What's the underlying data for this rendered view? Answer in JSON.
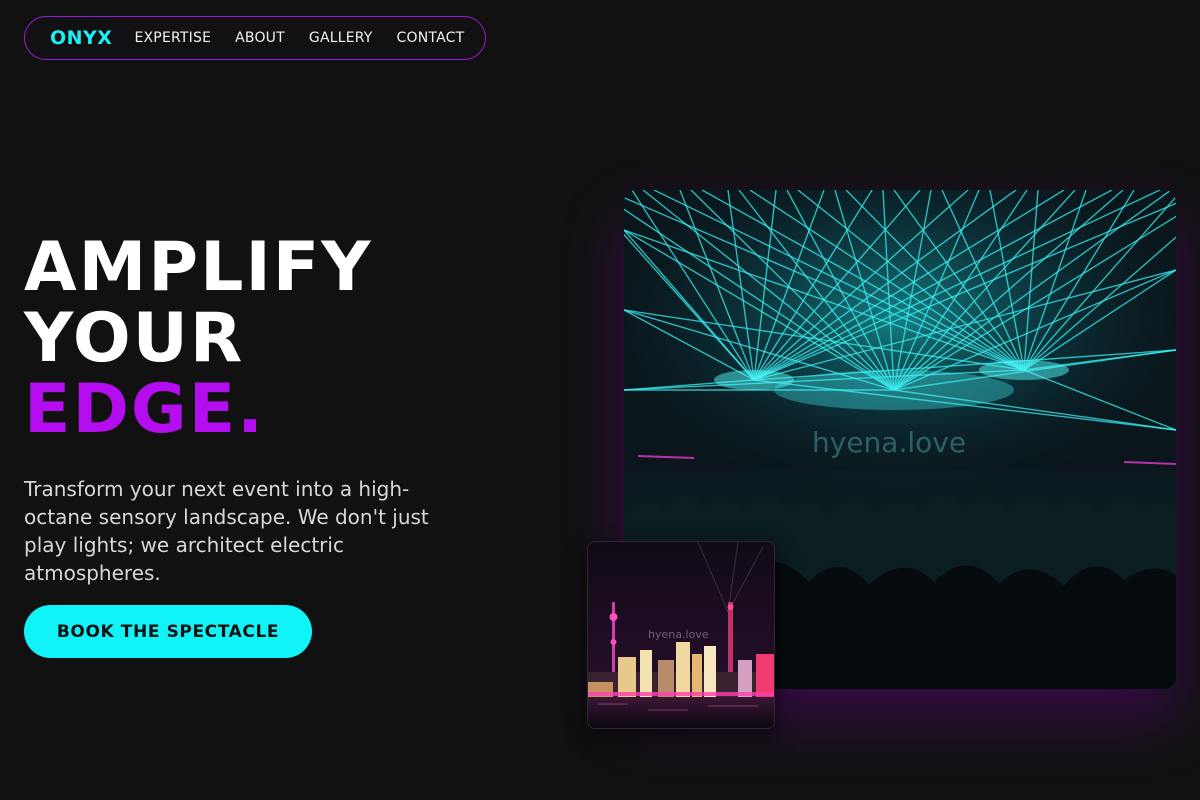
{
  "nav": {
    "logo": "ONYX",
    "links": [
      "EXPERTISE",
      "ABOUT",
      "GALLERY",
      "CONTACT"
    ]
  },
  "hero": {
    "headline_line1": "AMPLIFY",
    "headline_line2": "YOUR",
    "headline_accent": "EDGE.",
    "subcopy": "Transform your next event into a high-octane sensory landscape. We don't just play lights; we architect electric atmospheres.",
    "cta_label": "BOOK THE SPECTACLE"
  },
  "images": {
    "main_watermark": "hyena.love",
    "thumb_watermark": "hyena.love"
  },
  "colors": {
    "background": "#111112",
    "brand_cyan": "#10f3f7",
    "accent_purple": "#b30df0",
    "nav_border": "#9b1cd6"
  }
}
